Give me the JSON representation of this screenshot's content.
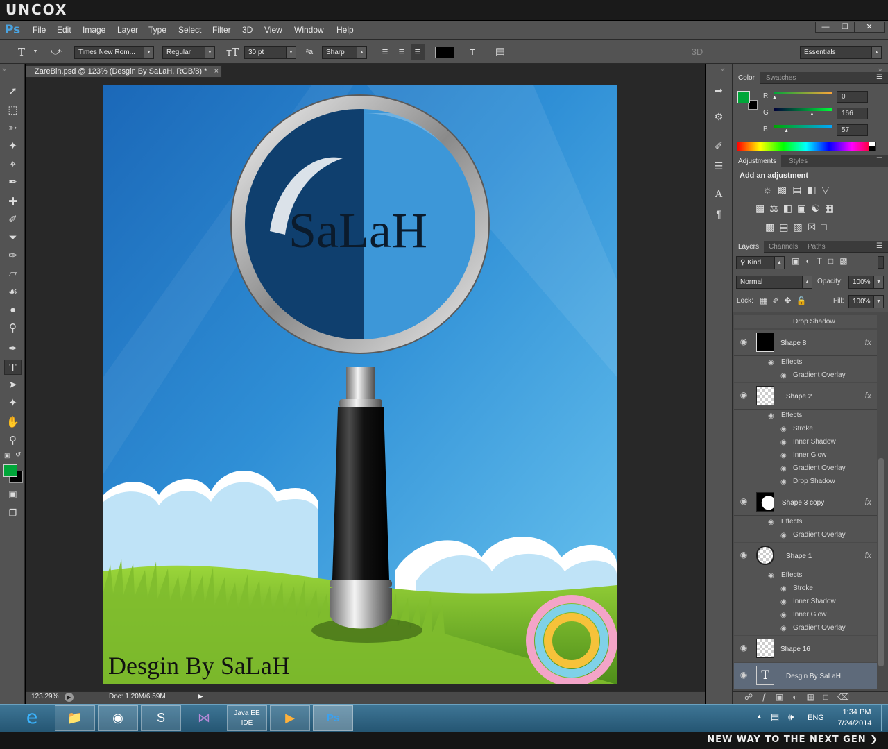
{
  "brand": "UNCOX",
  "app": {
    "logo": "Ps"
  },
  "menu": [
    "File",
    "Edit",
    "Image",
    "Layer",
    "Type",
    "Select",
    "Filter",
    "3D",
    "View",
    "Window",
    "Help"
  ],
  "window_controls": {
    "minimize": "—",
    "restore": "❐",
    "close": "✕"
  },
  "options": {
    "font_family": "Times New Rom...",
    "font_style": "Regular",
    "font_size": "30 pt",
    "antialias": "Sharp",
    "text_color": "#000000",
    "label_3d": "3D",
    "workspace": "Essentials"
  },
  "document": {
    "tab_title": "ZareBin.psd @ 123% (Desgin By SaLaH, RGB/8) *",
    "close": "×",
    "artwork_title": "SaLaH",
    "artwork_credit": "Desgin By SaLaH"
  },
  "status": {
    "zoom": "123.29%",
    "doc": "Doc: 1.20M/6.59M"
  },
  "foreground_color": "#00a639",
  "color_panel": {
    "tabs": [
      "Color",
      "Swatches"
    ],
    "channels": [
      {
        "label": "R",
        "value": "0"
      },
      {
        "label": "G",
        "value": "166"
      },
      {
        "label": "B",
        "value": "57"
      }
    ]
  },
  "adjustments_panel": {
    "tabs": [
      "Adjustments",
      "Styles"
    ],
    "heading": "Add an adjustment"
  },
  "layers_panel": {
    "tabs": [
      "Layers",
      "Channels",
      "Paths"
    ],
    "filter_kind": "Kind",
    "blend_mode": "Normal",
    "opacity_label": "Opacity:",
    "opacity": "100%",
    "lock_label": "Lock:",
    "fill_label": "Fill:",
    "fill": "100%",
    "top_effect": "Drop Shadow",
    "layers": [
      {
        "name": "Shape 8",
        "effects": [
          "Gradient Overlay"
        ]
      },
      {
        "name": "Shape 2",
        "effects": [
          "Stroke",
          "Inner Shadow",
          "Inner Glow",
          "Gradient Overlay",
          "Drop Shadow"
        ]
      },
      {
        "name": "Shape 3 copy",
        "effects": [
          "Gradient Overlay"
        ]
      },
      {
        "name": "Shape 1",
        "effects": [
          "Stroke",
          "Inner Shadow",
          "Inner Glow",
          "Gradient Overlay"
        ]
      },
      {
        "name": "Shape 16",
        "effects": []
      },
      {
        "name": "Desgin By SaLaH",
        "effects": []
      }
    ],
    "effects_label": "Effects",
    "fx": "fx"
  },
  "taskbar": {
    "apps": [
      "internet-explorer",
      "file-explorer",
      "firefox",
      "sublime-text",
      "visual-studio",
      "java-ee-ide",
      "media-player",
      "photoshop"
    ],
    "language": "ENG",
    "time": "1:34 PM",
    "date": "7/24/2014"
  },
  "tagline": "NEW WAY TO THE NEXT GEN"
}
